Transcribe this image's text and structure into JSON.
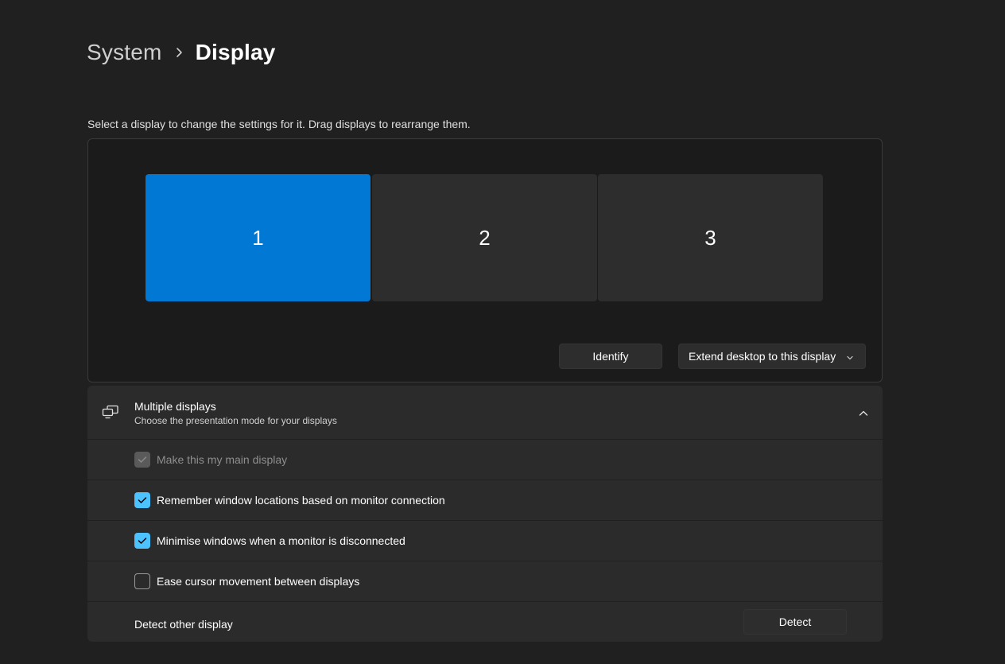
{
  "breadcrumb": {
    "parent": "System",
    "current": "Display"
  },
  "arrangement": {
    "instruction": "Select a display to change the settings for it. Drag displays to rearrange them.",
    "monitors": [
      {
        "label": "1",
        "selected": true
      },
      {
        "label": "2",
        "selected": false
      },
      {
        "label": "3",
        "selected": false
      }
    ],
    "identify_label": "Identify",
    "extend_label": "Extend desktop to this display"
  },
  "multiple_displays": {
    "title": "Multiple displays",
    "subtitle": "Choose the presentation mode for your displays",
    "options": [
      {
        "label": "Make this my main display",
        "checked": true,
        "disabled": true
      },
      {
        "label": "Remember window locations based on monitor connection",
        "checked": true,
        "disabled": false
      },
      {
        "label": "Minimise windows when a monitor is disconnected",
        "checked": true,
        "disabled": false
      },
      {
        "label": "Ease cursor movement between displays",
        "checked": false,
        "disabled": false
      }
    ],
    "detect_label": "Detect other display",
    "detect_button": "Detect"
  },
  "colors": {
    "accent": "#0078d4",
    "checkbox_accent": "#4cc2ff",
    "background": "#202020",
    "card": "#2b2b2b"
  },
  "icons": {
    "breadcrumb_separator": "chevron-right-icon",
    "extend_dropdown": "chevron-down-icon",
    "section": "multiple-displays-icon",
    "collapse": "chevron-up-icon",
    "checkbox_check": "checkmark-icon"
  }
}
